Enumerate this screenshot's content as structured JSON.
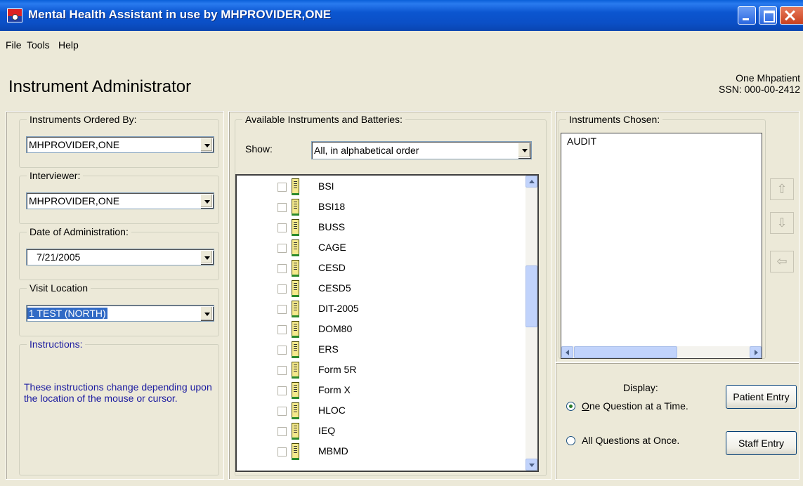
{
  "window": {
    "title": "Mental Health Assistant in use by MHPROVIDER,ONE"
  },
  "menu": {
    "items": [
      "File",
      "Tools",
      "Help"
    ]
  },
  "header": {
    "title": "Instrument Administrator",
    "patient_name": "One Mhpatient",
    "patient_ssn": "SSN: 000-00-2412"
  },
  "ordered_by": {
    "label": "Instruments Ordered By:",
    "value": "MHPROVIDER,ONE"
  },
  "interviewer": {
    "label": "Interviewer:",
    "value": "MHPROVIDER,ONE"
  },
  "date_admin": {
    "label": "Date of Administration:",
    "value": "7/21/2005"
  },
  "visit_location": {
    "label": "Visit Location",
    "value": "1 TEST (NORTH)"
  },
  "instructions": {
    "label": "Instructions:",
    "text": "These instructions change depending upon the location of the mouse or cursor."
  },
  "available": {
    "label": "Available Instruments and Batteries:",
    "show_label": "Show:",
    "show_value": "All, in alphabetical order",
    "items": [
      "BSI",
      "BSI18",
      "BUSS",
      "CAGE",
      "CESD",
      "CESD5",
      "DIT-2005",
      "DOM80",
      "ERS",
      "Form 5R",
      "Form X",
      "HLOC",
      "IEQ",
      "MBMD"
    ]
  },
  "chosen": {
    "label": "Instruments Chosen:",
    "items": [
      "AUDIT"
    ]
  },
  "display": {
    "label": "Display:",
    "option_one": "One Question at a Time.",
    "option_all": "All Questions at Once.",
    "selected": "one"
  },
  "buttons": {
    "patient_entry": "Patient Entry",
    "staff_entry": "Staff Entry"
  }
}
